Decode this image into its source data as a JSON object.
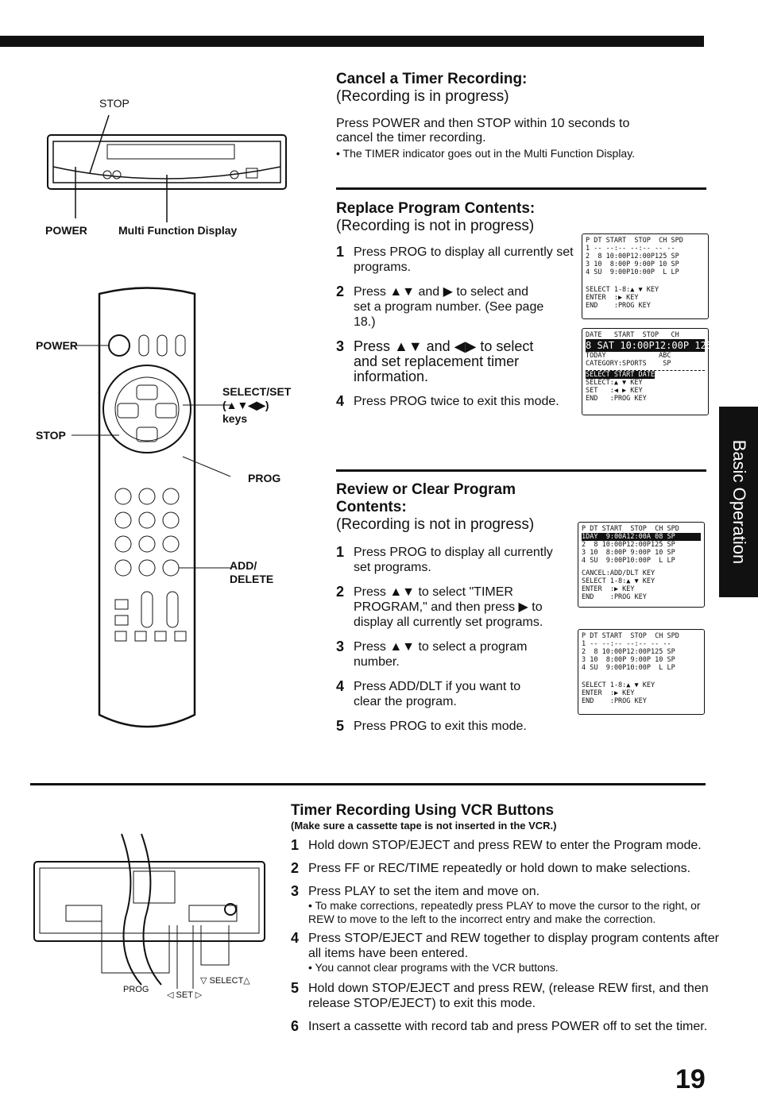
{
  "cancel": {
    "title": "Cancel a Timer Recording:",
    "subtitle": "(Recording is in progress)",
    "body": "Press POWER and then STOP within 10 seconds to cancel the timer recording.",
    "bullet": "• The TIMER indicator goes out in the Multi Function Display."
  },
  "vcr_top_labels": {
    "stop": "STOP",
    "power": "POWER",
    "mfd": "Multi Function Display"
  },
  "remote_labels": {
    "power": "POWER",
    "stop": "STOP",
    "select": "SELECT/SET",
    "select_keys": "(▲▼◀▶)",
    "keys": "keys",
    "prog": "PROG",
    "add": "ADD/",
    "delete": "DELETE"
  },
  "replace": {
    "title": "Replace Program Contents:",
    "subtitle": "(Recording is not in progress)",
    "steps": [
      {
        "n": "1",
        "text": "Press PROG to display all currently set programs."
      },
      {
        "n": "2",
        "text": "Press ▲▼ and ▶ to select and set a program number. (See page 18.)"
      },
      {
        "n": "3",
        "text": "Press ▲▼ and ◀▶ to select and set replacement timer information."
      },
      {
        "n": "4",
        "text": "Press PROG twice to exit this mode."
      }
    ]
  },
  "review": {
    "title": "Review or Clear Program Contents:",
    "subtitle": "(Recording is not in progress)",
    "steps": [
      {
        "n": "1",
        "text": "Press PROG to display all currently set programs."
      },
      {
        "n": "2",
        "text": "Press ▲▼ to select \"TIMER PROGRAM,\" and then press ▶ to display all currently set programs."
      },
      {
        "n": "3",
        "text": "Press ▲▼ to select a program number."
      },
      {
        "n": "4",
        "text": "Press ADD/DLT if you want to clear the program."
      },
      {
        "n": "5",
        "text": "Press PROG to exit this mode."
      }
    ]
  },
  "lcd": {
    "header": "P DT START  STOP  CH SPD",
    "row1_blank": "1 -- --:-- --:-- -- --",
    "row1_day": "1DAY  9:00A12:00A 08 SP",
    "row2": "2  8 10:00P12:00P125 SP",
    "row3": "3 10  8:00P 9:00P 10 SP",
    "row4": "4 SU  9:00P10:00P  L LP",
    "cancel": "CANCEL:ADD/DLT KEY",
    "select": "SELECT 1-8:▲ ▼ KEY",
    "enter": "ENTER  :▶ KEY",
    "end": "END    :PROG KEY",
    "edit_header": "DATE   START  STOP   CH",
    "edit_row": "8 SAT 10:00P12:00P 125",
    "edit_today": "TODAY             ABC",
    "edit_category": "CATEGORY:SPORTS    SP",
    "edit_prompt": "SELECT START DATE",
    "edit_select": "SELECT:▲ ▼ KEY",
    "edit_set": "SET   :◀ ▶ KEY",
    "edit_end": "END   :PROG KEY"
  },
  "vcr_buttons": {
    "title": "Timer Recording Using VCR Buttons",
    "note": "(Make sure a cassette tape is not inserted in the VCR.)",
    "labels": {
      "prog": "PROG",
      "set": "◁ SET ▷",
      "select": "▽ SELECT△"
    },
    "steps": [
      {
        "n": "1",
        "text": "Hold down STOP/EJECT and press REW to enter the Program mode."
      },
      {
        "n": "2",
        "text": "Press FF or REC/TIME repeatedly or hold down to make selections."
      },
      {
        "n": "3",
        "text": "Press PLAY to set the item and move on.",
        "bullet": "• To make corrections, repeatedly press PLAY to move the cursor to the right, or REW to move to the left to the incorrect entry and make the correction."
      },
      {
        "n": "4",
        "text": "Press STOP/EJECT and REW together to display program contents after all items have been entered.",
        "bullet": "• You cannot clear programs with the VCR buttons."
      },
      {
        "n": "5",
        "text": "Hold down STOP/EJECT and press REW, (release REW first, and then release STOP/EJECT) to exit this mode."
      },
      {
        "n": "6",
        "text": "Insert a cassette with record tab and press POWER off to set the timer."
      }
    ]
  },
  "side_tab": "Basic Operation",
  "page_number": "19"
}
